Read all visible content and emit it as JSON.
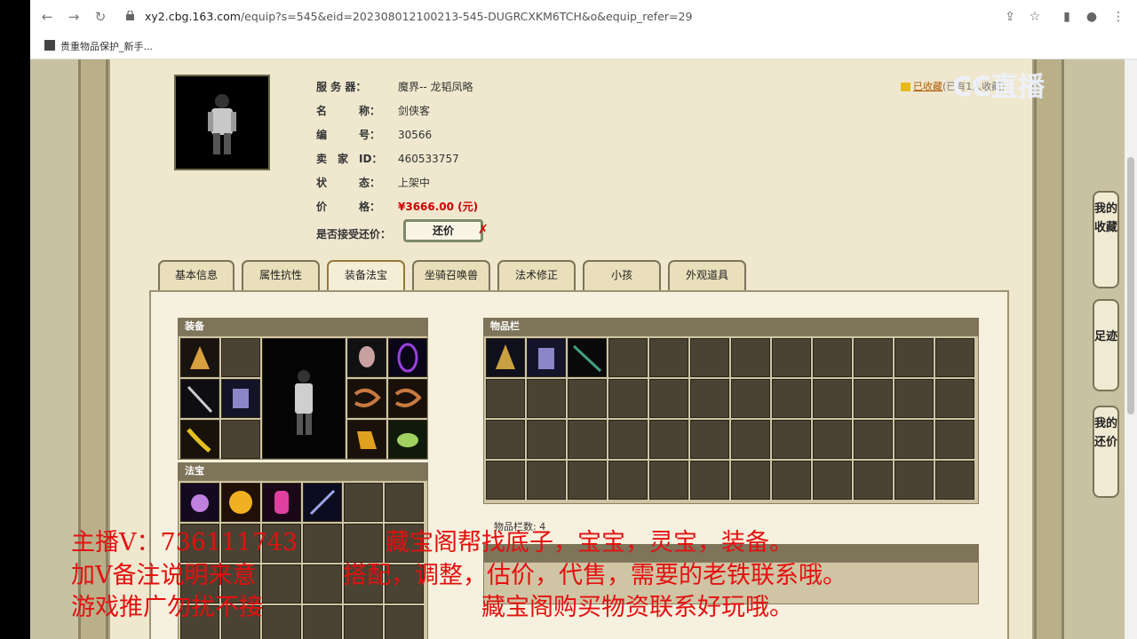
{
  "browser": {
    "url_host": "xy2.cbg.163.com",
    "url_path": "/equip?s=545&eid=202308012100213-545-DUGRCXKM6TCH&o&equip_refer=29",
    "bookmark": "贵重物品保护_新手..."
  },
  "watermark": "CC直播",
  "item": {
    "server_label": "服 务 器：",
    "server_value": "魔界-- 龙韬凤略",
    "name_label": "名　　　称：",
    "name_value": "剑侠客",
    "number_label": "编　　　号：",
    "number_value": "30566",
    "seller_label": "卖　家　ID：",
    "seller_value": "460533757",
    "status_label": "状　　　态：",
    "status_value": "上架中",
    "price_label": "价　　　格：",
    "price_value": "¥3666.00 (元)",
    "bargain_label": "是否接受还价：",
    "bargain_button": "还价",
    "bargain_mark": "✗"
  },
  "favorite": {
    "link": "已收藏",
    "count": "(已有1人收藏)"
  },
  "tabs": [
    "基本信息",
    "属性抗性",
    "装备法宝",
    "坐骑召唤兽",
    "法术修正",
    "小孩",
    "外观道具"
  ],
  "active_tab": 2,
  "sections": {
    "equipment": "装备",
    "fabao": "法宝",
    "inventory": "物品栏",
    "inventory_count": "物品栏数: 4"
  },
  "side_buttons": [
    "我的收藏",
    "足迹",
    "我的还价"
  ],
  "overlay": {
    "line1_left": "主播V：736111743",
    "line1_right": "藏宝阁帮找底子，宝宝，灵宝，装备。",
    "line2_left": "加V备注说明来意",
    "line2_right": "搭配，调整，估价，代售，需要的老铁联系哦。",
    "line3_left": "游戏推广勿扰不接",
    "line3_right": "藏宝阁购买物资联系好玩哦。"
  },
  "colors": {
    "overlay_red": "#e41010",
    "price_red": "#cc0000",
    "section_bar": "#7e745a"
  }
}
